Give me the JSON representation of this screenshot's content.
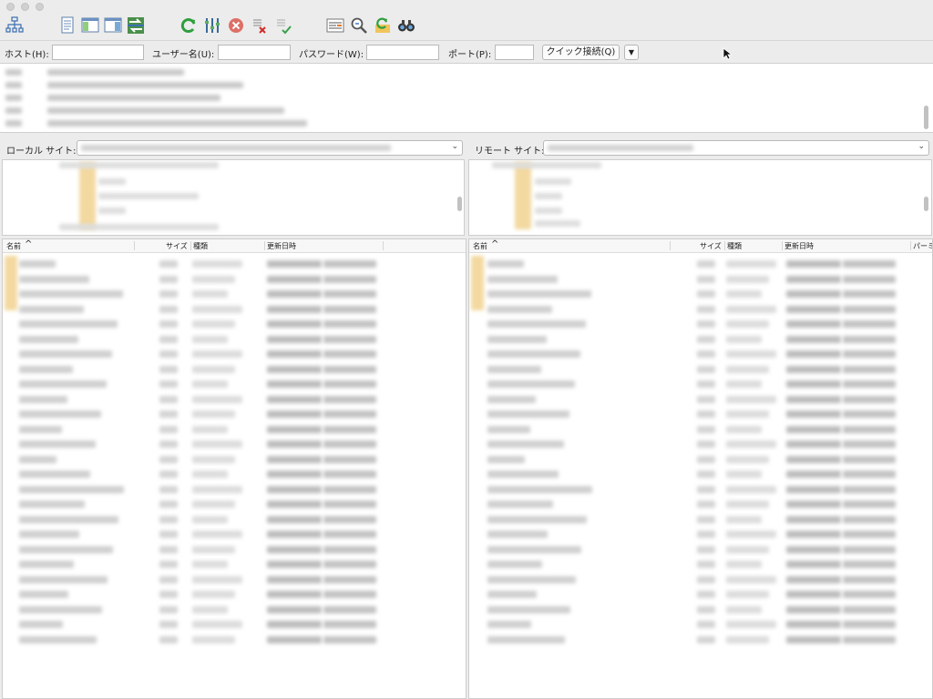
{
  "toolbar": {
    "icons": [
      "site-manager-icon",
      "toggle-log-icon",
      "toggle-local-tree-icon",
      "toggle-remote-tree-icon",
      "transfer-queue-icon",
      "refresh-icon",
      "filter-icon",
      "cancel-icon",
      "disconnect-icon",
      "reconnect-icon",
      "directory-compare-icon",
      "sync-browse-icon",
      "refresh-dir-icon",
      "find-icon"
    ]
  },
  "quickconnect": {
    "host_label": "ホスト(H):",
    "host_value": "",
    "user_label": "ユーザー名(U):",
    "user_value": "",
    "password_label": "パスワード(W):",
    "password_value": "",
    "port_label": "ポート(P):",
    "port_value": "",
    "connect_label": "クイック接続(Q)",
    "dropdown_glyph": "▼"
  },
  "local": {
    "site_label": "ローカル サイト:",
    "columns": [
      "名前",
      "サイズ",
      "種類",
      "更新日時"
    ],
    "sort_glyph": "^"
  },
  "remote": {
    "site_label": "リモート サイト:",
    "columns": [
      "名前",
      "サイズ",
      "種類",
      "更新日時",
      "パーミ"
    ],
    "sort_glyph": "^"
  },
  "colors": {
    "folder": "#f3d9a0",
    "accent_green": "#2e9e3e",
    "cancel_red": "#d9453a"
  }
}
